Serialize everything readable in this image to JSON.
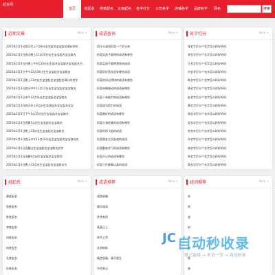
{
  "header": {
    "brand": "起名网",
    "nav": [
      "首页",
      "姓起名",
      "男孩起名",
      "女孩起名",
      "名字打分",
      "公司名字",
      "店铺名字",
      "品牌名字",
      "网名"
    ],
    "search_button": "搜索",
    "search_placeholder": ""
  },
  "panels": {
    "recent": {
      "title": "近期文章",
      "more": "More +",
      "items": [
        "2025年2月3日农历早上7点8分出生起名宝宝起名满分好听",
        "2025年2月3日农历晚上21点20分出生宝宝起名宝宝取名",
        "2025年2月3日日晚上午9点10分出生起名宝宝取名宝宝起名王不同",
        "2025年2月3日中午12点30分出生宝宝起名宝宝取名",
        "2025年2月3日晚上23点出生宝宝起名宝宝起名满分的名字",
        "2025年2月3日农历中午11点12分出生宝宝起名宝宝取名",
        "2025年2月3日中午12点半出生宝宝起名宝宝取名",
        "2025年2月3日农历早上6点出生女孩起名宝宝起名宝宝",
        "2025年2月3日下午1点15分出生宝宝起名宝宝取名",
        "2025年2月3日凌晨1点出生宝宝起名宝宝取名",
        "2025年2月3日晚上23点出生宝宝起名宝宝取名",
        "2025年2月3日农历中午13点20分出生宝宝起名宝宝取名名",
        "2025年2月3日凌晨出生宝宝起名宝宝取名名字",
        "2025年2月3日凌晨4点出生宝宝起名宝宝取名",
        "2025年2月3日晚上23点出生宝宝起名宝宝取名名"
      ]
    },
    "idioms": {
      "title": "成语查询",
      "more": "More +",
      "items": [
        "用什么成语形容一个好父亲",
        "形容女孩子聪明的成语有哪些",
        "形容女孩子聪明漂亮的成语",
        "形容好好西东西有哪些成语",
        "形容时间过得快的成语有哪些",
        "形容亲情感动的成语有哪些",
        "形容人有能力的成语有哪些",
        "形容成功努力的成语",
        "形容美好的成语有哪些",
        "形容大海优美的成语有哪些",
        "形容时间飞逝的成语",
        "形容朋友之间友谊的成语",
        "形容勤奋学习的成语有哪些",
        "形容开心的成语有哪些",
        "形容工作做事认真的成语",
        "形容工作做事认真的成语有哪些"
      ]
    },
    "score": {
      "title": "名字打分",
      "more": "More +",
      "items": [
        "张名字打分个名字怎么样好听吗",
        "李名字打分个名字怎么样好听吗",
        "王名字打分个名字怎么样好听吗",
        "刘名字打分个名字怎么样好听吗",
        "陈名字打分个名字怎么样好听吗",
        "杨名字打分个名字怎么样好听吗",
        "赵名字打分个名字怎么样好听吗",
        "黄名字打分个名字怎么样好听吗",
        "周名字打分个名字怎么样好听吗",
        "吴名字打分个名字怎么样好听吗",
        "徐名字打分个名字怎么样好听吗",
        "孙名字打分个名字怎么样好听吗",
        "胡名字打分个名字怎么样好听吗",
        "朱名字打分个名字怎么样好听吗",
        "高名字打分个名字怎么样好听吗",
        "林名字打分个名字怎么样好听吗"
      ]
    },
    "surname": {
      "title": "姓起名",
      "more": "More +",
      "items": [
        "黄姓起名",
        "张姓起名",
        "陈姓起名",
        "李姓起名",
        "何姓起名",
        "杭姓起名",
        "孔姓起名",
        "孙姓起名",
        "慧姓起名",
        "邵姓起名"
      ]
    },
    "idiom_rec": {
      "title": "成语推荐",
      "more": "More +",
      "items": [
        "改弦易辙",
        "威风凛凛",
        "井然有序",
        "蒸蒸日上",
        "举手之劳",
        "文质彬彬",
        "痛定思痛，痛不欲生",
        "不惊贵心"
      ]
    },
    "words": {
      "title": "组词推荐",
      "more": "More +",
      "items": [
        "朱",
        "房",
        "波",
        "杭",
        "杨",
        "浪",
        "陈",
        "林",
        "杉"
      ]
    }
  },
  "watermark": {
    "logo": "JC",
    "brand": "自动秒收录",
    "sub": "做上链接 → 来访一次 → 自动收录"
  },
  "colors": {
    "accent": "#e8202e",
    "background": "#f0f0f0"
  }
}
